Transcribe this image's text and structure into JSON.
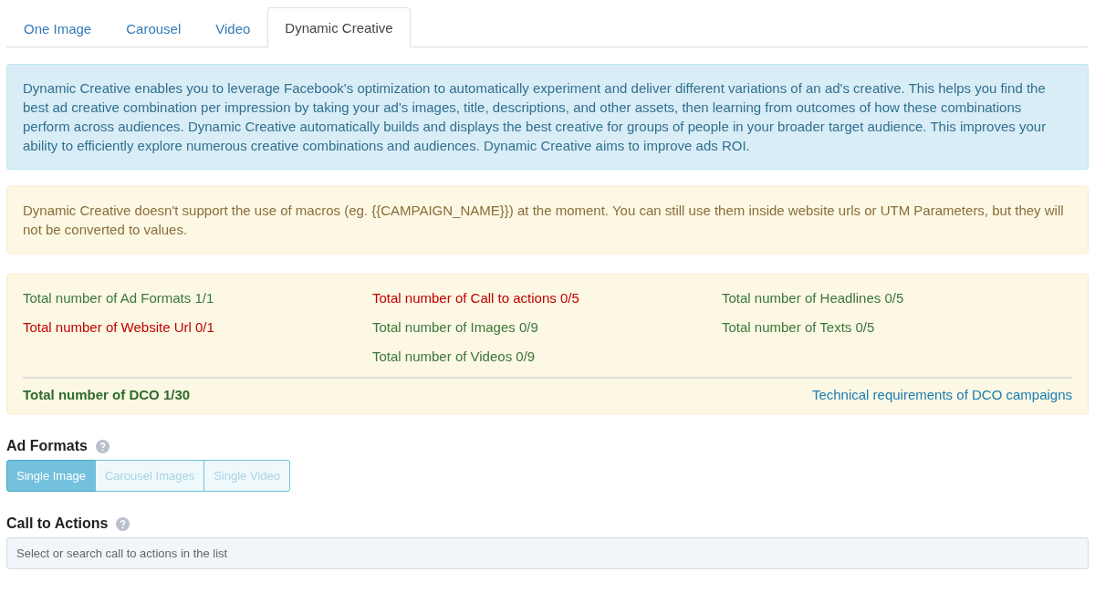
{
  "tabs": [
    {
      "label": "One Image",
      "selected": false
    },
    {
      "label": "Carousel",
      "selected": false
    },
    {
      "label": "Video",
      "selected": false
    },
    {
      "label": "Dynamic Creative",
      "selected": true
    }
  ],
  "info_alert": "Dynamic Creative enables you to leverage Facebook's optimization to automatically experiment and deliver different variations of an ad's creative. This helps you find the best ad creative combination per impression by taking your ad's images, title, descriptions, and other assets, then learning from outcomes of how these combinations perform across audiences. Dynamic Creative automatically builds and displays the best creative for groups of people in your broader target audience. This improves your ability to efficiently explore numerous creative combinations and audiences. Dynamic Creative aims to improve ads ROI.",
  "warning_alert": "Dynamic Creative doesn't support the use of macros (eg. {{CAMPAIGN_NAME}}) at the moment. You can still use them inside website urls or UTM Parameters, but they will not be converted to values.",
  "totals": {
    "columns": [
      [
        {
          "label": "Total number of Ad Formats 1/1",
          "met": true
        },
        {
          "label": "Total number of Website Url 0/1",
          "met": false
        }
      ],
      [
        {
          "label": "Total number of Call to actions 0/5",
          "met": false
        },
        {
          "label": "Total number of Images 0/9",
          "met": true
        },
        {
          "label": "Total number of Videos 0/9",
          "met": true
        }
      ],
      [
        {
          "label": "Total number of Headlines 0/5",
          "met": true
        },
        {
          "label": "Total number of Texts 0/5",
          "met": true
        }
      ]
    ],
    "dco_total": "Total number of DCO 1/30",
    "requirements_link": "Technical requirements of DCO campaigns"
  },
  "ad_formats": {
    "title": "Ad Formats",
    "options": [
      {
        "label": "Single Image",
        "selected": true
      },
      {
        "label": "Carousel Images",
        "selected": false
      },
      {
        "label": "Single Video",
        "selected": false
      }
    ]
  },
  "call_to_actions": {
    "title": "Call to Actions",
    "placeholder": "Select or search call to actions in the list"
  }
}
